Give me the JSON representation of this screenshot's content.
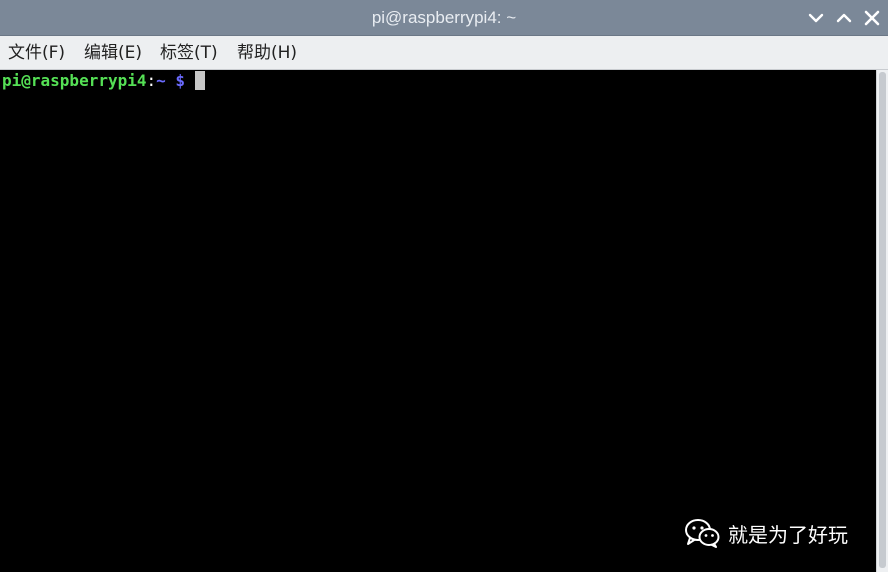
{
  "window": {
    "title": "pi@raspberrypi4: ~"
  },
  "menu": {
    "file": "文件(F)",
    "edit": "编辑(E)",
    "tabs": "标签(T)",
    "help": "帮助(H)"
  },
  "terminal": {
    "prompt_user_host": "pi@raspberrypi4",
    "prompt_colon": ":",
    "prompt_path": "~",
    "prompt_symbol": "$"
  },
  "watermark": {
    "text": "就是为了好玩",
    "icon": "wechat-icon"
  },
  "colors": {
    "titlebar": "#7b8898",
    "menubar": "#edeff1",
    "terminal_bg": "#000000",
    "prompt_user": "#55e055",
    "prompt_path": "#6b6bff",
    "cursor": "#c7c7c7"
  },
  "icons": {
    "minimize": "chevron-down-icon",
    "maximize": "chevron-up-icon",
    "close": "close-icon"
  }
}
